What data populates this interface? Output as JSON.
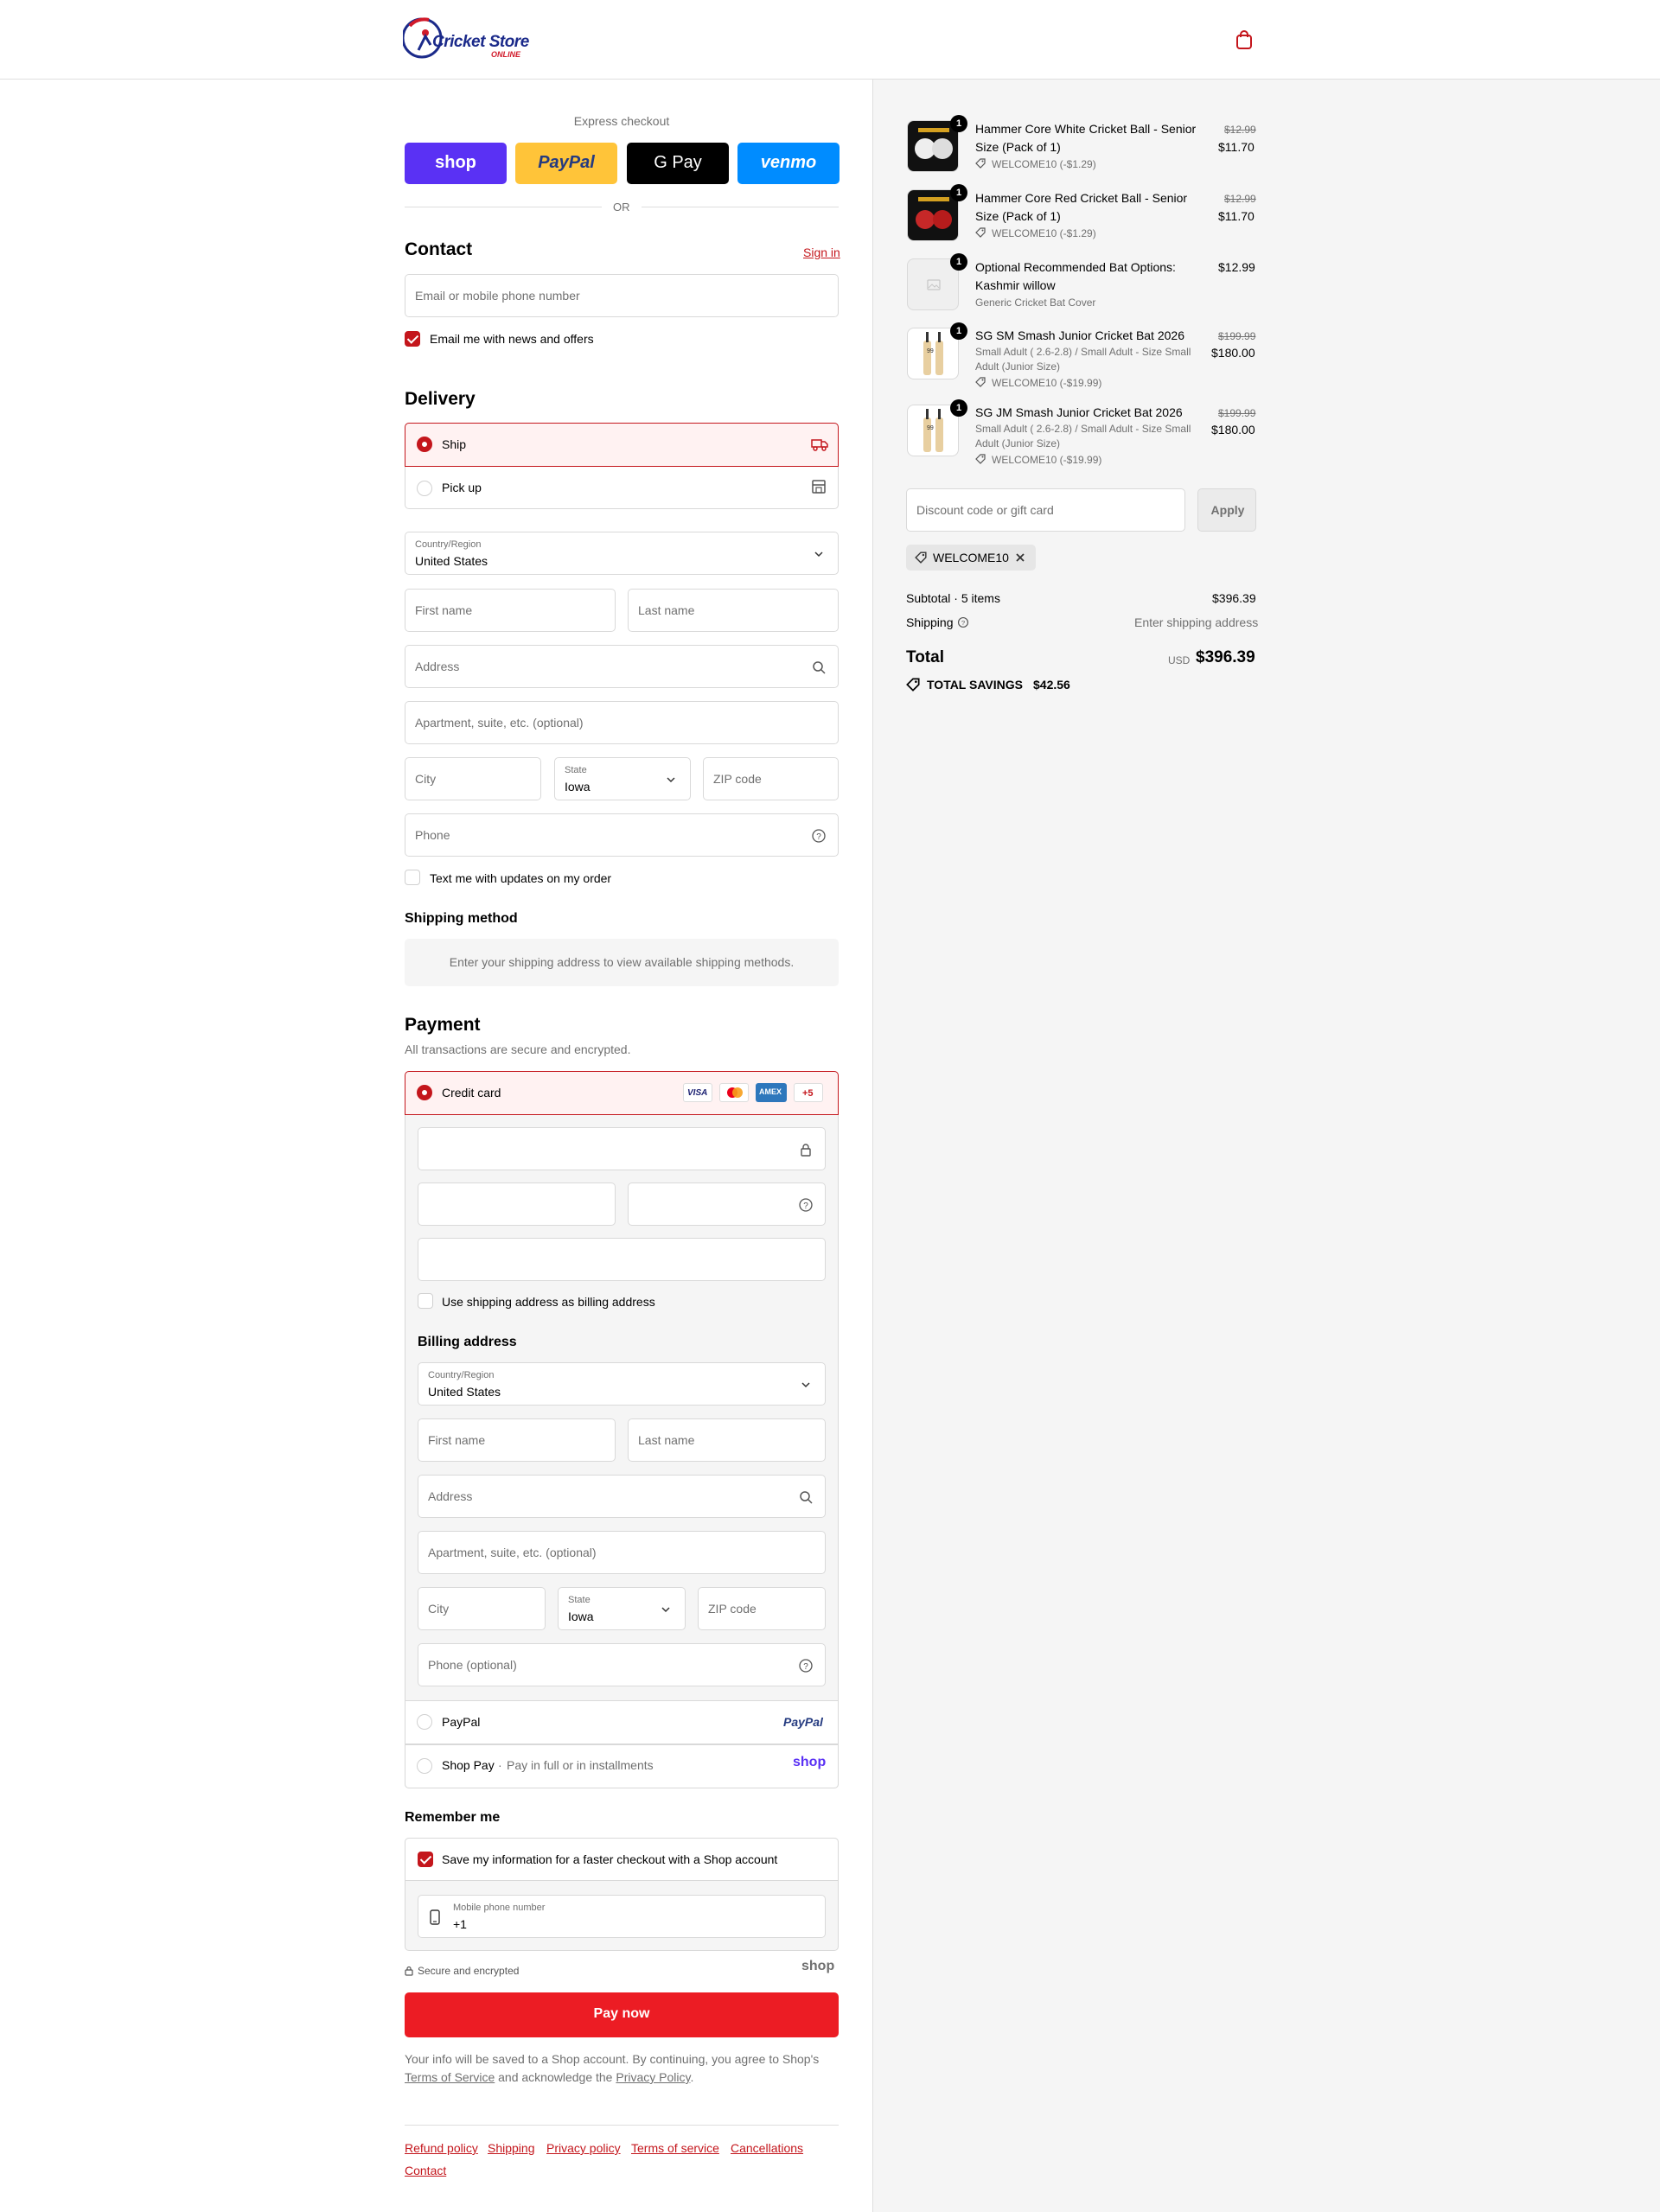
{
  "header": {
    "logo_line1": "Cricket Store",
    "logo_line2": "ONLINE"
  },
  "express": {
    "title": "Express checkout",
    "buttons": [
      "shop",
      "PayPal",
      "G Pay",
      "venmo"
    ],
    "or": "OR"
  },
  "contact": {
    "title": "Contact",
    "signin": "Sign in",
    "email_placeholder": "Email or mobile phone number",
    "newsletter_label": "Email me with news and offers"
  },
  "delivery": {
    "title": "Delivery",
    "options": [
      "Ship",
      "Pick up"
    ],
    "country_label": "Country/Region",
    "country_value": "United States",
    "first_name": "First name",
    "last_name": "Last name",
    "address": "Address",
    "apartment": "Apartment, suite, etc. (optional)",
    "city": "City",
    "state_label": "State",
    "state_value": "Iowa",
    "zip": "ZIP code",
    "phone": "Phone",
    "sms_label": "Text me with updates on my order"
  },
  "shipping_method": {
    "title": "Shipping method",
    "notice": "Enter your shipping address to view available shipping methods."
  },
  "payment": {
    "title": "Payment",
    "subtitle": "All transactions are secure and encrypted.",
    "credit_card": "Credit card",
    "card_brands": [
      "VISA",
      "MC",
      "AMEX"
    ],
    "more_brands": "+5",
    "use_shipping_label": "Use shipping address as billing address",
    "billing_title": "Billing address",
    "billing_country_label": "Country/Region",
    "billing_country_value": "United States",
    "billing_first_name": "First name",
    "billing_last_name": "Last name",
    "billing_address": "Address",
    "billing_apartment": "Apartment, suite, etc. (optional)",
    "billing_city": "City",
    "billing_state_label": "State",
    "billing_state_value": "Iowa",
    "billing_zip": "ZIP code",
    "billing_phone": "Phone (optional)",
    "paypal": "PayPal",
    "paypal_logo": "PayPal",
    "shoppay": "Shop Pay",
    "shoppay_note": "Pay in full or in installments",
    "shop_logo": "shop"
  },
  "remember": {
    "title": "Remember me",
    "save_label": "Save my information for a faster checkout with a Shop account",
    "mobile_label": "Mobile phone number",
    "mobile_value": "+1",
    "secure": "Secure and encrypted",
    "shop_logo": "shop"
  },
  "pay_button": "Pay now",
  "legal": {
    "line1": "Your info will be saved to a Shop account. By continuing, you agree to Shop's",
    "terms": "Terms of Service",
    "and": "and acknowledge the",
    "privacy": "Privacy Policy",
    "period": "."
  },
  "footer_links": [
    "Refund policy",
    "Shipping",
    "Privacy policy",
    "Terms of service",
    "Cancellations",
    "Contact"
  ],
  "summary": {
    "items": [
      {
        "name_l1": "Hammer Core White Cricket Ball - Senior",
        "name_l2": "Size (Pack of 1)",
        "variant": "",
        "variant2": "",
        "discount": "WELCOME10 (-$1.29)",
        "old_price": "$12.99",
        "price": "$11.70",
        "qty": "1"
      },
      {
        "name_l1": "Hammer Core Red Cricket Ball - Senior",
        "name_l2": "Size (Pack of 1)",
        "variant": "",
        "variant2": "",
        "discount": "WELCOME10 (-$1.29)",
        "old_price": "$12.99",
        "price": "$11.70",
        "qty": "1"
      },
      {
        "name_l1": "Optional Recommended Bat Options:",
        "name_l2": "Kashmir willow",
        "variant": "Generic Cricket Bat Cover",
        "variant2": "",
        "discount": "",
        "old_price": "",
        "price": "$12.99",
        "qty": "1"
      },
      {
        "name_l1": "SG SM Smash Junior Cricket Bat 2026",
        "name_l2": "",
        "variant": "Small Adult ( 2.6-2.8) / Small Adult - Size Small",
        "variant2": "Adult (Junior Size)",
        "discount": "WELCOME10 (-$19.99)",
        "old_price": "$199.99",
        "price": "$180.00",
        "qty": "1"
      },
      {
        "name_l1": "SG JM Smash Junior Cricket Bat 2026",
        "name_l2": "",
        "variant": "Small Adult ( 2.6-2.8) / Small Adult - Size Small",
        "variant2": "Adult (Junior Size)",
        "discount": "WELCOME10 (-$19.99)",
        "old_price": "$199.99",
        "price": "$180.00",
        "qty": "1"
      }
    ],
    "discount_placeholder": "Discount code or gift card",
    "apply": "Apply",
    "applied_code": "WELCOME10",
    "subtotal_label": "Subtotal · 5 items",
    "subtotal_value": "$396.39",
    "shipping_label": "Shipping",
    "shipping_value": "Enter shipping address",
    "total_label": "Total",
    "currency": "USD",
    "total_value": "$396.39",
    "savings_label": "TOTAL SAVINGS",
    "savings_value": "$42.56"
  },
  "colors": {
    "accent": "#c4161c",
    "pay_button": "#ec1c24",
    "shop_purple": "#5a31f4",
    "paypal_yellow": "#ffc439",
    "venmo_blue": "#008cff"
  }
}
